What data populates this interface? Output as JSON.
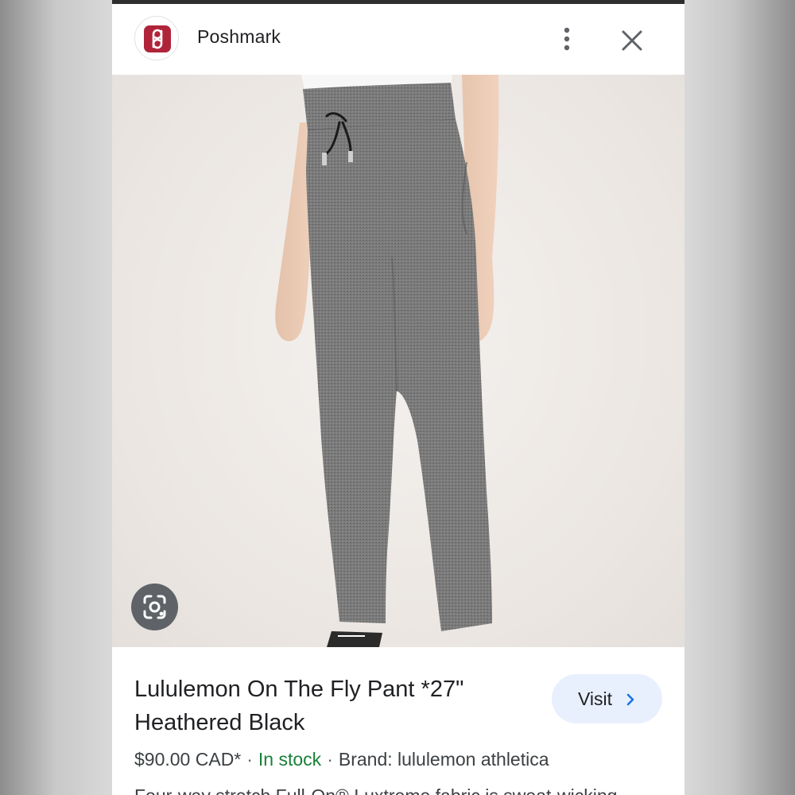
{
  "header": {
    "site_name": "Poshmark",
    "favicon_icon": "poshmark-logo-icon",
    "favicon_color": "#b0243a",
    "more_icon": "more-vert-icon",
    "close_icon": "close-icon"
  },
  "image": {
    "subject": "grey heathered jogger pants",
    "lens_icon": "google-lens-icon"
  },
  "product": {
    "title": "Lululemon On The Fly Pant *27\" Heathered Black",
    "visit_label": "Visit",
    "visit_color": "#e8f0fe",
    "price": "$90.00 CAD*",
    "separator": "·",
    "stock": "In stock",
    "stock_color": "#188038",
    "brand": "Brand: lululemon athletica",
    "description": "Four-way stretch Full-On® Luxtreme fabric is sweat-wicking"
  }
}
